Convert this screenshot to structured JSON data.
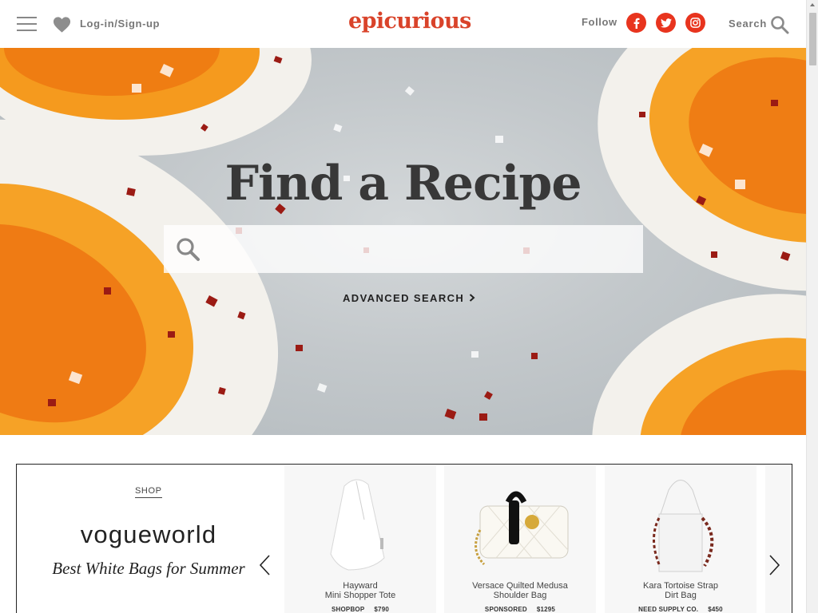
{
  "header": {
    "login_label": "Log-in/Sign-up",
    "logo_text": "epicurious",
    "follow_label": "Follow",
    "social": [
      {
        "name": "facebook",
        "glyph": "f"
      },
      {
        "name": "twitter",
        "glyph": "t"
      },
      {
        "name": "instagram",
        "glyph": "ig"
      }
    ],
    "search_label": "Search"
  },
  "hero": {
    "title": "Find a Recipe",
    "search_value": "",
    "search_placeholder": "",
    "advanced_search_label": "ADVANCED SEARCH",
    "advanced_search_chevron": ">"
  },
  "shop": {
    "label": "SHOP",
    "brand": "vogueworld",
    "subtitle": "Best White Bags for Summer",
    "products": [
      {
        "name_line1": "Hayward",
        "name_line2": "Mini Shopper Tote",
        "seller": "SHOPBOP",
        "price": "$790"
      },
      {
        "name_line1": "Versace Quilted Medusa",
        "name_line2": "Shoulder Bag",
        "seller": "SPONSORED",
        "price": "$1295"
      },
      {
        "name_line1": "Kara Tortoise Strap",
        "name_line2": "Dirt Bag",
        "seller": "NEED SUPPLY CO.",
        "price": "$450"
      }
    ]
  },
  "colors": {
    "brand_red": "#d9432a",
    "social_red": "#e8341e"
  },
  "icons": [
    "menu-icon",
    "heart-icon",
    "facebook-icon",
    "twitter-icon",
    "instagram-icon",
    "search-icon",
    "chevron-right-icon",
    "chevron-left-icon"
  ]
}
